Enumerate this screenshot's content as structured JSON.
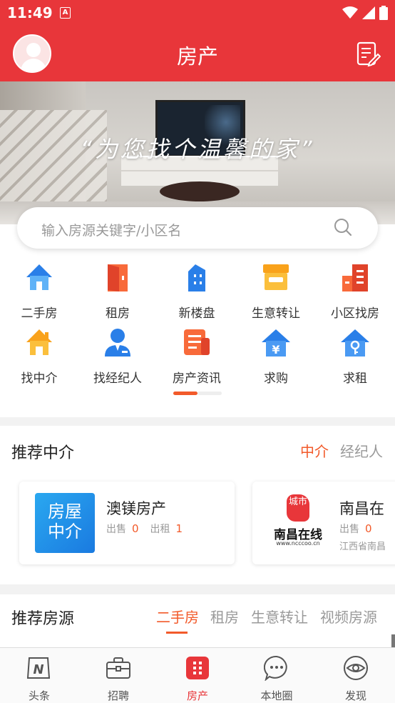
{
  "status_bar": {
    "time": "11:49",
    "a_badge": "A"
  },
  "header": {
    "title": "房产"
  },
  "banner": {
    "slogan": "“为您找个温馨的家”"
  },
  "search": {
    "placeholder": "输入房源关键字/小区名"
  },
  "categories": [
    {
      "label": "二手房",
      "icon": "house-icon"
    },
    {
      "label": "租房",
      "icon": "door-icon"
    },
    {
      "label": "新楼盘",
      "icon": "building-icon"
    },
    {
      "label": "生意转让",
      "icon": "shop-icon"
    },
    {
      "label": "小区找房",
      "icon": "apartment-icon"
    },
    {
      "label": "找中介",
      "icon": "agency-house-icon"
    },
    {
      "label": "找经纪人",
      "icon": "agent-icon"
    },
    {
      "label": "房产资讯",
      "icon": "news-icon"
    },
    {
      "label": "求购",
      "icon": "yuan-house-icon"
    },
    {
      "label": "求租",
      "icon": "key-house-icon"
    }
  ],
  "agencies_section": {
    "title": "推荐中介",
    "tabs": [
      "中介",
      "经纪人"
    ],
    "active_tab": "中介",
    "cards": [
      {
        "logo_text_1": "房屋",
        "logo_text_2": "中介",
        "name": "澳镁房产",
        "sale_label": "出售",
        "sale_count": "0",
        "rent_label": "出租",
        "rent_count": "1",
        "address": ""
      },
      {
        "logo_text_1": "城市",
        "logo_text_2": "南昌在线",
        "logo_url": "www.ncccoo.cn",
        "name": "南昌在",
        "sale_label": "出售",
        "sale_count": "0",
        "rent_label": "",
        "rent_count": "",
        "address": "江西省南昌"
      }
    ]
  },
  "listings_section": {
    "title": "推荐房源",
    "tabs": [
      "二手房",
      "租房",
      "生意转让",
      "视频房源"
    ],
    "active_tab": "二手房"
  },
  "bottom_nav": [
    {
      "label": "头条",
      "icon": "news-n-icon",
      "active": false
    },
    {
      "label": "招聘",
      "icon": "briefcase-icon",
      "active": false
    },
    {
      "label": "房产",
      "icon": "property-grid-icon",
      "active": true
    },
    {
      "label": "本地圈",
      "icon": "chat-bubble-icon",
      "active": false
    },
    {
      "label": "发现",
      "icon": "eye-icon",
      "active": false
    }
  ],
  "colors": {
    "brand_red": "#e8363a",
    "accent_orange": "#f25a2a",
    "blue": "#2a7fe8"
  }
}
